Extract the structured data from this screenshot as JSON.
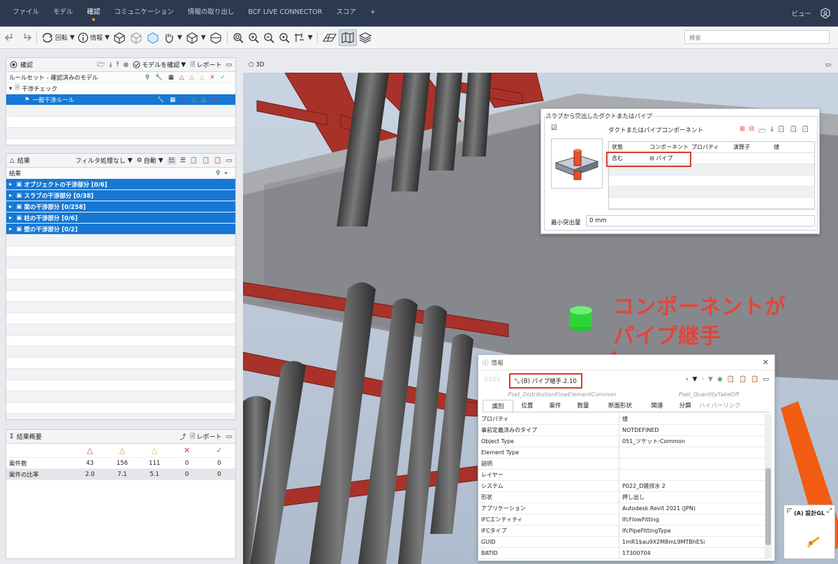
{
  "menu": {
    "items": [
      "ファイル",
      "モデル",
      "確認",
      "コミュニケーション",
      "情報の取り出し",
      "BCF LIVE CONNECTOR",
      "スコア",
      "+"
    ],
    "active": "確認",
    "view_label": "ビュー"
  },
  "toolbar": {
    "rotate_label": "回転",
    "info_label": "情報",
    "search_placeholder": "検索"
  },
  "check_panel": {
    "title": "確認",
    "check_model_label": "モデルを確認",
    "report_label": "レポート",
    "ruleset_header": "ルールセット - 確認済みのモデル",
    "tree": [
      {
        "label": "干渉チェック",
        "level": 0
      },
      {
        "label": "一般干渉ルール",
        "level": 1
      }
    ]
  },
  "results_panel": {
    "title": "結果",
    "filter_label": "フィルタ処理なし",
    "auto_label": "自動",
    "column_header": "結果",
    "items": [
      "オブジェクトの干渉部分 [0/6]",
      "スラブの干渉部分 [0/38]",
      "梁の干渉部分 [0/258]",
      "柱の干渉部分 [0/6]",
      "壁の干渉部分 [0/2]"
    ]
  },
  "summary_panel": {
    "title": "結果概要",
    "report_label": "レポート",
    "rows": [
      {
        "label": "案件数",
        "values": [
          "43",
          "156",
          "111",
          "0",
          "0"
        ]
      },
      {
        "label": "案件の比率",
        "values": [
          "2.0",
          "7.1",
          "5.1",
          "0",
          "0"
        ]
      }
    ]
  },
  "viewport": {
    "tab_label": "3D",
    "nav_cube_label": "(A) 設計GL"
  },
  "rule_dialog": {
    "title": "スラブから突出したダクトまたはパイプ",
    "component_label": "ダクトまたはパイプコンポーネント",
    "columns": [
      "状態",
      "コンポーネント",
      "プロパティ",
      "演算子",
      "値"
    ],
    "row": {
      "state": "含む",
      "component": "パイプ"
    },
    "min_label": "最小突出量",
    "min_value": "0 mm"
  },
  "annotation": {
    "line1": "コンポーネントが",
    "line2": "パイプ継手"
  },
  "info_panel": {
    "title": "情報",
    "object_name": "(B) パイプ継手.2.10",
    "pset_tabs": [
      "Pset_DistributionFlowElementCommon",
      "Pset_QuantityTakeOff"
    ],
    "tabs": [
      "識別",
      "位置",
      "案件",
      "数量",
      "断面形状",
      "関連",
      "分類",
      "ハイパーリンク"
    ],
    "header_key": "プロパティ",
    "header_value": "値",
    "rows": [
      {
        "k": "事前定義済みのタイプ",
        "v": "NOTDEFINED"
      },
      {
        "k": "Object Type",
        "v": "051_ソケット:Common"
      },
      {
        "k": "Element Type",
        "v": ""
      },
      {
        "k": "説明",
        "v": ""
      },
      {
        "k": "レイヤー",
        "v": ""
      },
      {
        "k": "システム",
        "v": "P022_D雑排水 2"
      },
      {
        "k": "形状",
        "v": "押し出し"
      },
      {
        "k": "アプリケーション",
        "v": "Autodesk Revit 2021 (JPN)"
      },
      {
        "k": "IFCエンティティ",
        "v": "IfcFlowFitting"
      },
      {
        "k": "IFCタイプ",
        "v": "IfcPipeFittingType"
      },
      {
        "k": "GUID",
        "v": "1mR1$au9X2M8mL9MTBhESi"
      },
      {
        "k": "BATID",
        "v": "17300704"
      }
    ]
  },
  "colors": {
    "topbar": "#2b3a4e",
    "accent": "#f7a21b",
    "selection": "#1678d4",
    "annotation": "#e4443a",
    "steel": "#a8322a"
  }
}
